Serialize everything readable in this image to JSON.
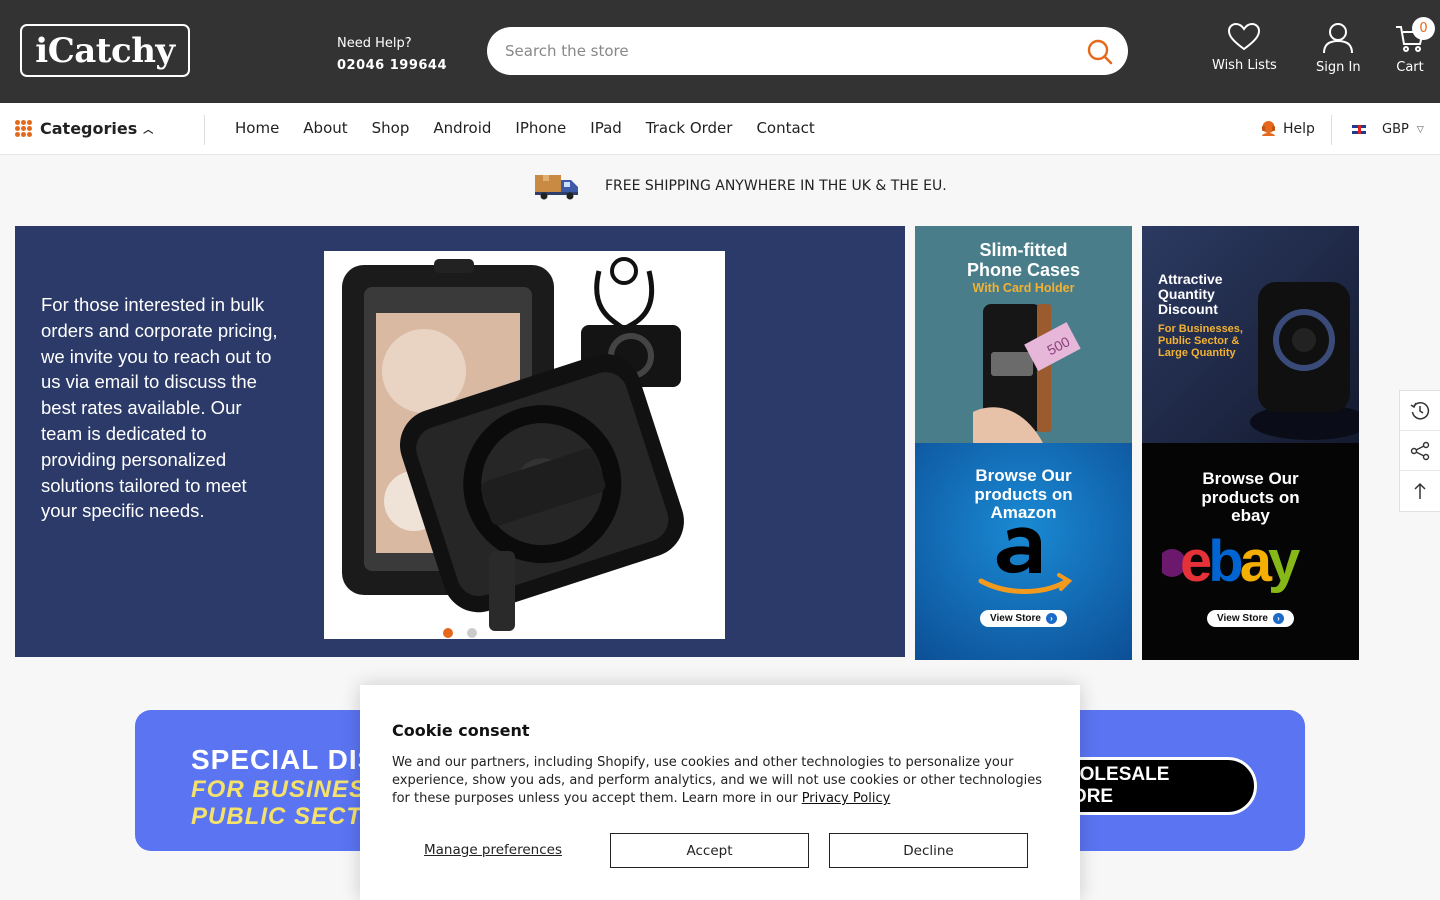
{
  "header": {
    "logo_text": "iCatchy",
    "need_help_label": "Need Help?",
    "phone": "02046 199644",
    "search_placeholder": "Search the store",
    "wishlist_label": "Wish Lists",
    "signin_label": "Sign In",
    "cart_label": "Cart",
    "cart_count": "0"
  },
  "nav": {
    "categories_label": "Categories",
    "items": [
      "Home",
      "About",
      "Shop",
      "Android",
      "IPhone",
      "IPad",
      "Track Order",
      "Contact"
    ],
    "help_label": "Help",
    "currency": "GBP"
  },
  "shipping_notice": "FREE SHIPPING ANYWHERE IN THE UK & THE EU.",
  "hero": {
    "text": "For those interested in bulk orders and corporate pricing, we invite you to reach out to us via email to discuss the best rates available. Our team is dedicated to providing personalized solutions tailored to meet your specific needs.",
    "slide_count": 2,
    "active_slide": 1
  },
  "promos": {
    "phone_cases": {
      "line1": "Slim-fitted",
      "line2": "Phone Cases",
      "line3": "With Card Holder",
      "price_tag": "500"
    },
    "quantity_discount": {
      "line1": "Attractive",
      "line2": "Quantity",
      "line3": "Discount",
      "sub1": "For Businesses,",
      "sub2": "Public Sector &",
      "sub3": "Large Quantity"
    },
    "amazon": {
      "line1": "Browse Our",
      "line2": "products on",
      "line3": "Amazon",
      "button": "View Store"
    },
    "ebay": {
      "line1": "Browse Our",
      "line2": "products on",
      "line3": "ebay",
      "button": "View Store"
    }
  },
  "wholesale": {
    "title": "SPECIAL DIS",
    "sub1": "FOR BUSINESS",
    "sub2": "PUBLIC SECTO",
    "button": "WHOLESALE STORE"
  },
  "cookie": {
    "title": "Cookie consent",
    "body": "We and our partners, including Shopify, use cookies and other technologies to personalize your experience, show you ads, and perform analytics, and we will not use cookies or other technologies for these purposes unless you accept them. Learn more in our ",
    "privacy_link": "Privacy Policy",
    "manage": "Manage preferences",
    "accept": "Accept",
    "decline": "Decline"
  },
  "colors": {
    "header_bg": "#333333",
    "accent": "#e5691c",
    "hero_bg": "#2b3a68",
    "wholesale_bg": "#5b74f2"
  },
  "icons": [
    "search-icon",
    "heart-icon",
    "user-icon",
    "cart-icon",
    "grid-icon",
    "headset-icon",
    "truck-icon",
    "history-icon",
    "share-icon",
    "arrow-up-icon"
  ]
}
